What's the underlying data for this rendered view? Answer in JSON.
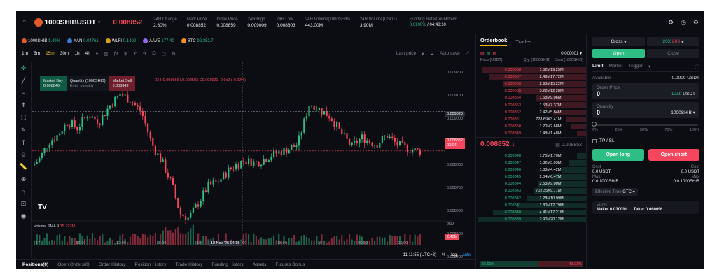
{
  "header": {
    "symbol": "1000SHIBUSDT",
    "price": "0.008852",
    "stats": [
      {
        "label": "24H Change",
        "value": "2.60%",
        "cls": "g"
      },
      {
        "label": "Mark Price",
        "value": "0.008852",
        "cls": "w"
      },
      {
        "label": "Index Price",
        "value": "0.008859",
        "cls": "w"
      },
      {
        "label": "24H High",
        "value": "0.009009",
        "cls": "w"
      },
      {
        "label": "24H Low",
        "value": "0.008603",
        "cls": "w"
      },
      {
        "label": "24H Volume(1000SHIB)",
        "value": "443.00M",
        "cls": "w"
      },
      {
        "label": "24H Volume(USDT)",
        "value": "3.90M",
        "cls": "w"
      }
    ],
    "funding_label": "Funding Rate/Countdown",
    "funding_rate": "0.0100%",
    "countdown": "/ 04:48:10"
  },
  "tickers": [
    {
      "name": "1000SHIB",
      "chg": "1.49%",
      "cls": "g",
      "color": "#e05a2a"
    },
    {
      "name": "XAN",
      "chg": "0.04761",
      "cls": "g",
      "color": "#3a7bd5"
    },
    {
      "name": "WLFI",
      "chg": "0.1402",
      "cls": "g",
      "color": "#d4a017"
    },
    {
      "name": "AAVE",
      "chg": "177.40",
      "cls": "g",
      "color": "#8e6cf0"
    },
    {
      "name": "BTC",
      "chg": "92,352.7",
      "cls": "g",
      "color": "#f7931a"
    }
  ],
  "toolbar": {
    "intervals": [
      "1m",
      "5m",
      "15m",
      "30m",
      "1h",
      "4h"
    ],
    "active": "15m",
    "last_price": "Last price",
    "autosave": "Auto save"
  },
  "quick_trade": {
    "buy_label": "Market Buy",
    "buy_price": "0.008846",
    "qty_label": "Quantity (1000SHIB)",
    "qty_placeholder": "Enter quantity",
    "sell_label": "Market Sell",
    "sell_price": "0.008849"
  },
  "ohlc": {
    "open": "0.008556",
    "high": "H0.008556",
    "low": "L0.008503",
    "close": "C0.008521",
    "change": "-0.0x2 (-0.02%)",
    "num": "23"
  },
  "y_ticks": [
    "0.009200",
    "0.009100",
    "0.009000",
    "0.008900",
    "0.008800",
    "0.008700",
    "0.008600",
    "0.008500",
    "0.008400"
  ],
  "y_marker": "0.009023",
  "y_last": "0.008852",
  "y_countdown": "03:04",
  "vol_tick": "25M",
  "vol_last": "2.43M",
  "x_ticks": [
    "17",
    "06:00",
    "12:00",
    "18:00",
    "18",
    "12:00",
    "18:00",
    "19",
    "06:00",
    "12:00"
  ],
  "x_cursor": "18 Nov '25",
  "x_cursor_time": "04:15",
  "volume_label": "Volume SMA 9",
  "volume_val": "15.797M",
  "status": {
    "time": "11:11:55 (UTC+8)",
    "pct": "%",
    "log": "log",
    "auto": "auto"
  },
  "bottom_tabs": [
    "Positions(0)",
    "Open Orders(0)",
    "Order History",
    "Position History",
    "Trade History",
    "Funding History",
    "Assets",
    "Futures Bonus"
  ],
  "orderbook": {
    "tabs": [
      "Orderbook",
      "Trades"
    ],
    "precision": "0.000001",
    "headers": [
      "Price (USDT)",
      "Qty. (1000SHIB)",
      "Sum (1000SHIB)"
    ],
    "asks": [
      [
        "0.008858",
        "1.52M",
        "19.25M",
        0.95
      ],
      [
        "0.008857",
        "2.49M",
        "17.72M",
        0.88
      ],
      [
        "0.008856",
        "2.93M",
        "15.22M",
        0.76
      ],
      [
        "0.008855",
        "3.22M",
        "12.28M",
        0.62
      ],
      [
        "0.008854",
        "1.68M",
        "9.06M",
        0.46
      ],
      [
        "0.008853",
        "1.53M",
        "7.37M",
        0.38
      ],
      [
        "0.008852",
        "2.42M",
        "5.84M",
        0.3
      ],
      [
        "0.008851",
        "728.69K",
        "3.41M",
        0.18
      ],
      [
        "0.008850",
        "1.20M",
        "2.68M",
        0.14
      ],
      [
        "0.008849",
        "1.48M",
        "1.48M",
        0.08
      ]
    ],
    "mid_price": "0.008852 ↓",
    "mid_mark": "0.008852",
    "bids": [
      [
        "0.008848",
        "1.70M",
        "1.70M",
        0.08
      ],
      [
        "0.008847",
        "1.32M",
        "3.03M",
        0.15
      ],
      [
        "0.008846",
        "1.38M",
        "4.42M",
        0.22
      ],
      [
        "0.008845",
        "2.04M",
        "6.47M",
        0.32
      ],
      [
        "0.008844",
        "2.53M",
        "9.00M",
        0.44
      ],
      [
        "0.008843",
        "702.35K",
        "9.71M",
        0.48
      ],
      [
        "0.008842",
        "1.28M",
        "10.99M",
        0.54
      ],
      [
        "0.008841",
        "1.80M",
        "12.79M",
        0.63
      ],
      [
        "0.008840",
        "4.41M",
        "17.21M",
        0.85
      ],
      [
        "0.008839",
        "2.90M",
        "20.12M",
        0.98
      ]
    ],
    "buy_ratio": "56.09%",
    "sell_ratio": "43.91%",
    "buy_frac": 0.5609
  },
  "trade": {
    "margin_mode": "Cross",
    "leverage_long": "20X",
    "leverage_short": "20X",
    "open": "Open",
    "close": "Close",
    "order_tabs": [
      "Limit",
      "Market",
      "Trigger"
    ],
    "available_label": "Available",
    "available": "0.0000 USDT",
    "price_label": "Order Price",
    "price_value": "0",
    "last": "Last",
    "price_unit": "USDT",
    "qty_label": "Quantity",
    "qty_value": "0",
    "qty_unit": "1000SHIB",
    "slider_ticks": [
      "0%",
      "25%",
      "50%",
      "75%",
      "100%"
    ],
    "tpsl": "TP / SL",
    "open_long": "Open long",
    "open_short": "Open short",
    "cost_label": "Cost",
    "cost_long": "0.0 USDT",
    "cost_short": "0.0 USDT",
    "max_label": "Max",
    "max_long": "0.0 1000SHIB",
    "max_short": "0.0 1000SHIB",
    "eff_time": "Effective Time",
    "gtc": "GTC",
    "vip": "VIP 0",
    "maker": "Maker 0.0300%",
    "taker": "Taker 0.0600%"
  },
  "colors": {
    "up": "#2ebd85",
    "down": "#f6465d",
    "accent": "#f0b90b"
  }
}
